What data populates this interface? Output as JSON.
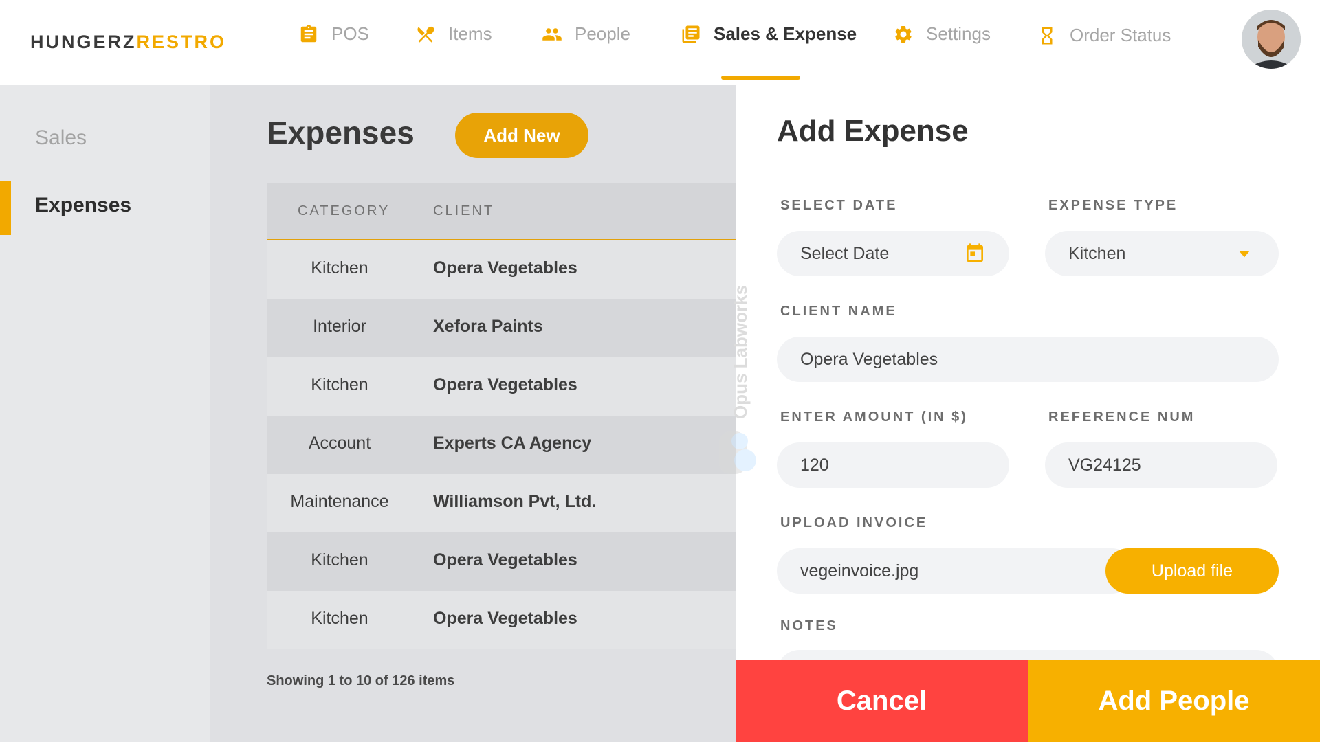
{
  "header": {
    "logo_part1": "HUNGERZ",
    "logo_part2": "RESTRO",
    "nav": [
      {
        "label": "POS",
        "icon": "clipboard-icon"
      },
      {
        "label": "Items",
        "icon": "utensils-icon"
      },
      {
        "label": "People",
        "icon": "people-icon"
      },
      {
        "label": "Sales & Expense",
        "icon": "document-icon",
        "active": true
      },
      {
        "label": "Settings",
        "icon": "gear-icon"
      },
      {
        "label": "Order Status",
        "icon": "hourglass-icon"
      }
    ]
  },
  "sidebar": {
    "items": [
      {
        "label": "Sales"
      },
      {
        "label": "Expenses",
        "active": true
      }
    ]
  },
  "main": {
    "title": "Expenses",
    "add_new_label": "Add New",
    "columns": [
      "CATEGORY",
      "CLIENT"
    ],
    "rows": [
      {
        "category": "Kitchen",
        "client": "Opera Vegetables"
      },
      {
        "category": "Interior",
        "client": "Xefora Paints"
      },
      {
        "category": "Kitchen",
        "client": "Opera Vegetables"
      },
      {
        "category": "Account",
        "client": "Experts CA Agency"
      },
      {
        "category": "Maintenance",
        "client": "Williamson Pvt, Ltd."
      },
      {
        "category": "Kitchen",
        "client": "Opera Vegetables"
      },
      {
        "category": "Kitchen",
        "client": "Opera Vegetables"
      }
    ],
    "showing": "Showing 1 to 10 of 126 items"
  },
  "panel": {
    "title": "Add Expense",
    "date_label": "SELECT DATE",
    "date_placeholder": "Select Date",
    "expense_type_label": "EXPENSE TYPE",
    "expense_type_value": "Kitchen",
    "client_name_label": "CLIENT NAME",
    "client_name_value": "Opera Vegetables",
    "amount_label": "ENTER AMOUNT (IN $)",
    "amount_value": "120",
    "reference_label": "REFERENCE NUM",
    "reference_value": "VG24125",
    "upload_label": "UPLOAD INVOICE",
    "upload_filename": "vegeinvoice.jpg",
    "upload_button": "Upload file",
    "notes_label": "NOTES",
    "cancel_label": "Cancel",
    "submit_label": "Add People"
  },
  "watermark": "Opus Labworks",
  "colors": {
    "accent": "#f7b000",
    "cancel": "#ff4340",
    "active_text": "#333333",
    "inactive_text": "#a6a6a6"
  }
}
